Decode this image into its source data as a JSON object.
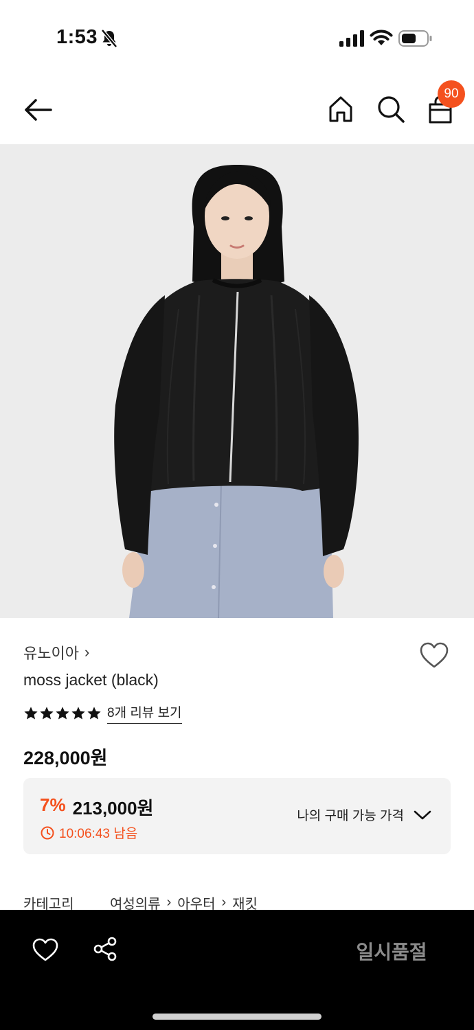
{
  "status_bar": {
    "time": "1:53"
  },
  "header": {
    "cart_count": "90"
  },
  "product": {
    "brand": "유노이아",
    "brand_chevron": "›",
    "name": "moss jacket (black)",
    "rating_stars": 5,
    "review_link": "8개 리뷰 보기",
    "original_price": "228,000원"
  },
  "price_box": {
    "discount_rate": "7%",
    "discount_price": "213,000원",
    "timer": "10:06:43 남음",
    "dropdown_label": "나의 구매 가능 가격"
  },
  "category": {
    "label": "카테고리",
    "path": [
      "여성의류",
      "아우터",
      "재킷"
    ]
  },
  "bottom_bar": {
    "action_label": "일시품절"
  },
  "colors": {
    "accent": "#f4511e",
    "bar_bg": "#000000",
    "price_box_bg": "#f3f3f3"
  }
}
